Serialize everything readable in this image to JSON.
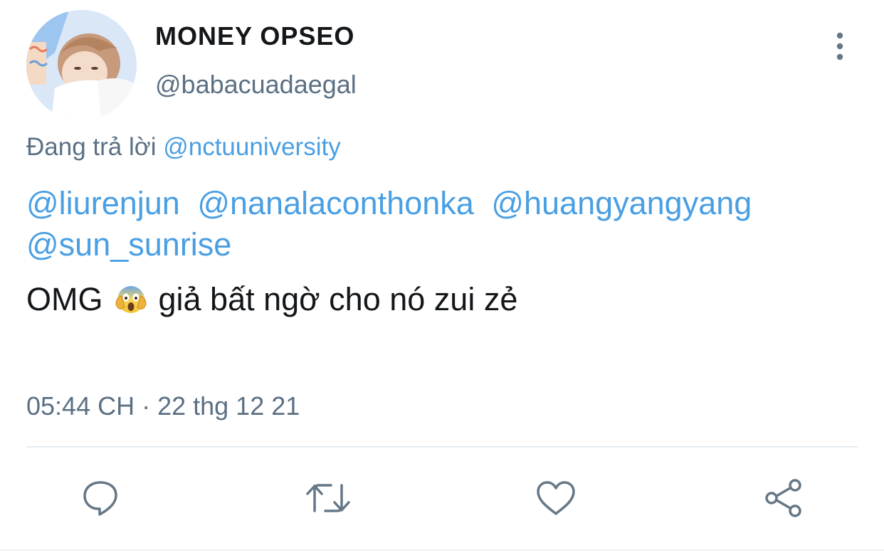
{
  "tweet": {
    "display_name": "MONEY OPSEO",
    "handle": "@babacuadaegal",
    "replying_prefix": "Đang trả lời",
    "replying_to": "@nctuuniversity",
    "mentions": [
      "@liurenjun",
      "@nanalaconthonka",
      "@huangyangyang",
      "@sun_sunrise"
    ],
    "text_before_emoji": "OMG",
    "emoji": "face-screaming-in-fear",
    "text_after_emoji": "giả bất ngờ cho nó zui zẻ",
    "timestamp": "05:44 CH · 22 thg 12 21"
  },
  "actions": {
    "icons": [
      "reply-icon",
      "retweet-icon",
      "like-icon",
      "share-icon"
    ]
  },
  "colors": {
    "link": "#4a9fe3",
    "secondary_text": "#5b7083",
    "primary_text": "#14171a",
    "icon": "#657786",
    "divider": "#e6ecf0"
  }
}
